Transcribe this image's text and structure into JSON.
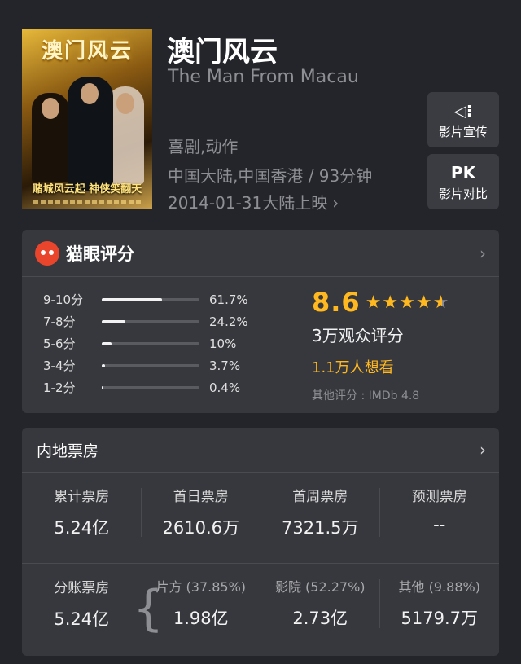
{
  "movie": {
    "poster_title": "澳门风云",
    "poster_slogan": "赌城风云起 神侠笑翻天",
    "title": "澳门风云",
    "title_en": "The Man From Macau",
    "genre": "喜剧,动作",
    "region_duration": "中国大陆,中国香港 / 93分钟",
    "release": "2014-01-31大陆上映",
    "release_chevron": "›"
  },
  "side_buttons": [
    {
      "icon": "speaker-icon",
      "glyph": "◁⁝",
      "label": "影片宣传"
    },
    {
      "icon": "pk-text-icon",
      "glyph": "PK",
      "label": "影片对比"
    }
  ],
  "rating": {
    "header": "猫眼评分",
    "chevron": "›",
    "distribution": [
      {
        "label": "9-10分",
        "pct": "61.7%",
        "fraction": 0.617
      },
      {
        "label": "7-8分",
        "pct": "24.2%",
        "fraction": 0.242
      },
      {
        "label": "5-6分",
        "pct": "10%",
        "fraction": 0.1
      },
      {
        "label": "3-4分",
        "pct": "3.7%",
        "fraction": 0.037
      },
      {
        "label": "1-2分",
        "pct": "0.4%",
        "fraction": 0.004
      }
    ],
    "score": "8.6",
    "stars_filled": 4.5,
    "count": "3万观众评分",
    "want": "1.1万人想看",
    "other": "其他评分 : IMDb 4.8",
    "accent_color": "#ffb820"
  },
  "box_office": {
    "header": "内地票房",
    "chevron": "›",
    "row1": [
      {
        "label": "累计票房",
        "value": "5.24亿"
      },
      {
        "label": "首日票房",
        "value": "2610.6万"
      },
      {
        "label": "首周票房",
        "value": "7321.5万"
      },
      {
        "label": "预测票房",
        "value": "--"
      }
    ],
    "row2": [
      {
        "label": "分账票房",
        "value": "5.24亿"
      },
      {
        "label": "片方 (37.85%)",
        "value": "1.98亿"
      },
      {
        "label": "影院 (52.27%)",
        "value": "2.73亿"
      },
      {
        "label": "其他 (9.88%)",
        "value": "5179.7万"
      }
    ]
  }
}
